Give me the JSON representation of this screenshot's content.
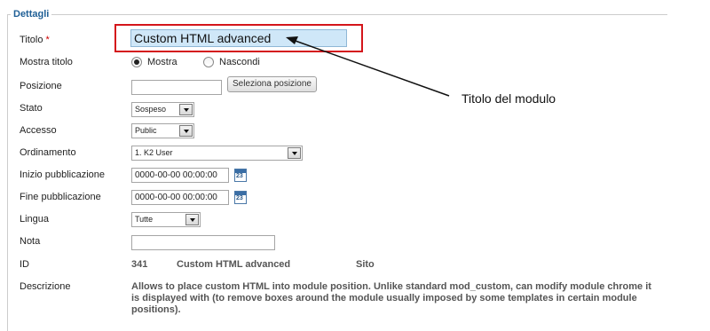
{
  "legend": "Dettagli",
  "callout": "Titolo del modulo",
  "fields": {
    "titolo": {
      "label": "Titolo",
      "required_mark": "*",
      "value": "Custom HTML advanced"
    },
    "mostra_titolo": {
      "label": "Mostra titolo",
      "options": [
        "Mostra",
        "Nascondi"
      ],
      "selected": "Mostra"
    },
    "posizione": {
      "label": "Posizione",
      "value": "",
      "button": "Seleziona posizione"
    },
    "stato": {
      "label": "Stato",
      "value": "Sospeso"
    },
    "accesso": {
      "label": "Accesso",
      "value": "Public"
    },
    "ordinamento": {
      "label": "Ordinamento",
      "value": "1. K2 User"
    },
    "inizio": {
      "label": "Inizio pubblicazione",
      "value": "0000-00-00 00:00:00"
    },
    "fine": {
      "label": "Fine pubblicazione",
      "value": "0000-00-00 00:00:00"
    },
    "lingua": {
      "label": "Lingua",
      "value": "Tutte"
    },
    "nota": {
      "label": "Nota",
      "value": ""
    },
    "id": {
      "label": "ID",
      "value": "341",
      "module_name": "Custom HTML advanced",
      "client": "Sito"
    },
    "descrizione": {
      "label": "Descrizione",
      "value": "Allows to place custom HTML into module position. Unlike standard mod_custom, can modify module chrome it is displayed with (to remove boxes around the module usually imposed by some templates in certain module positions)."
    }
  },
  "calendar_day": "23",
  "icons": {
    "calendar": "calendar-icon",
    "dropdown": "chevron-down-icon"
  },
  "colors": {
    "highlight_border": "#d4151b",
    "legend": "#1f5f96",
    "title_input_bg": "#cfe7f8"
  }
}
